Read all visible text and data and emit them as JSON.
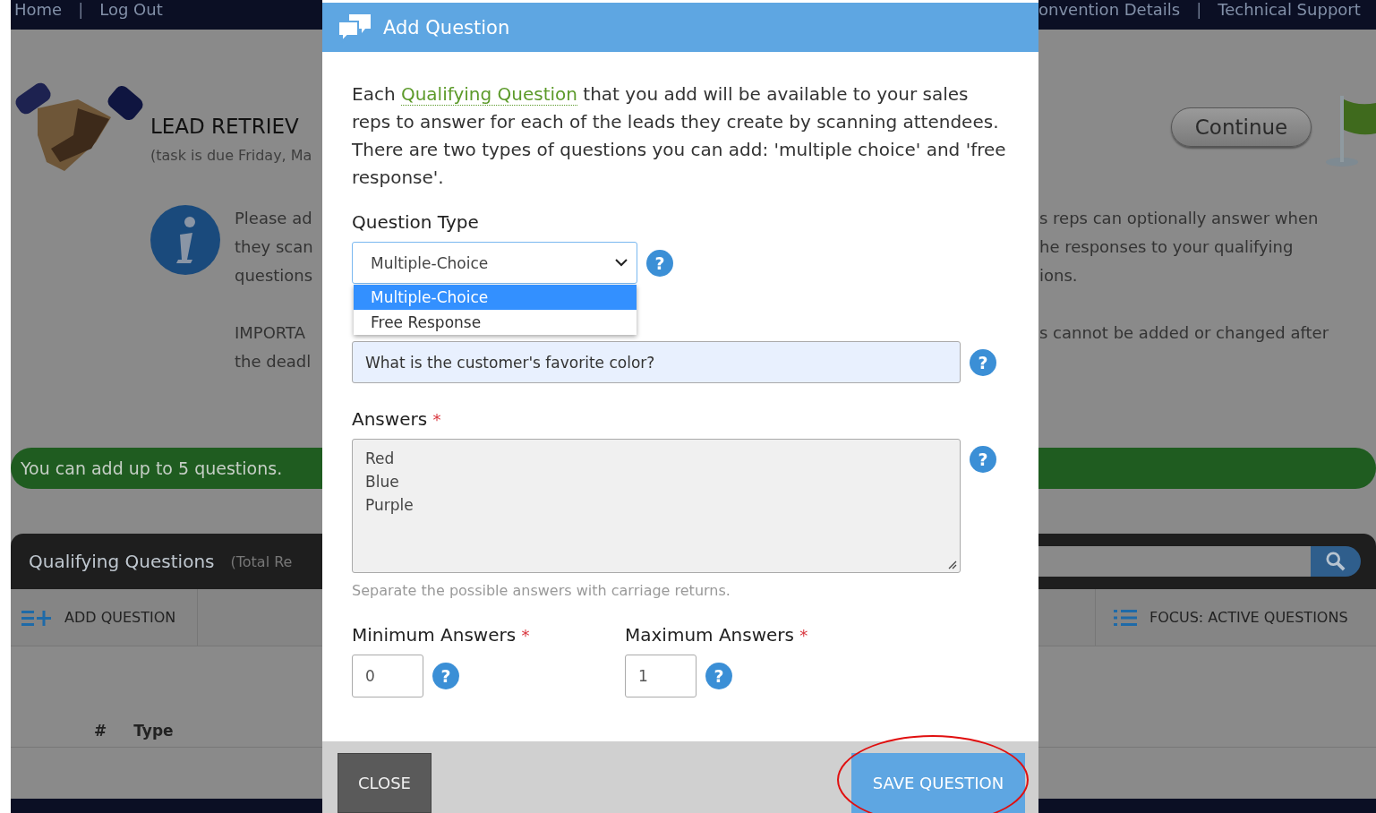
{
  "top_nav": {
    "left": [
      {
        "kind": "link",
        "text": "Home"
      },
      {
        "kind": "separator",
        "text": "|"
      },
      {
        "kind": "link",
        "text": "Log Out"
      }
    ],
    "right": [
      {
        "kind": "link",
        "text": "onvention Details"
      },
      {
        "kind": "separator",
        "text": "|"
      },
      {
        "kind": "link",
        "text": "Technical Support"
      }
    ]
  },
  "page": {
    "title": "LEAD RETRIEV",
    "subtitle": "(task is due Friday, Ma",
    "continue_button": "Continue",
    "info_left": [
      [
        "Please ad",
        "they scan",
        "questions"
      ],
      [
        "IMPORTA",
        "the deadl"
      ]
    ],
    "info_right": [
      [
        "s reps can optionally answer when",
        "he responses to your qualifying",
        "ions."
      ],
      [
        "s cannot be added or changed after"
      ]
    ],
    "banner": "You can add up to 5 questions.",
    "panel": {
      "title": "Qualifying Questions",
      "subtitle": "(Total Re",
      "add_button": "ADD QUESTION",
      "focus_button": "FOCUS: ACTIVE QUESTIONS",
      "columns": [
        "#",
        "Type"
      ]
    }
  },
  "modal": {
    "title": "Add Question",
    "intro_before": "Each ",
    "intro_link": "Qualifying Question",
    "intro_after": " that you add will be available to your sales reps to answer for each of the leads they create by scanning attendees. There are two types of questions you can add: 'multiple choice' and 'free response'.",
    "question_type": {
      "label": "Question Type",
      "value": "Multiple-Choice",
      "help": "?",
      "options": [
        {
          "text": "Multiple-Choice",
          "selected": true
        },
        {
          "text": "Free Response",
          "selected": false
        }
      ]
    },
    "question": {
      "value": "What is the customer's favorite color?",
      "help": "?"
    },
    "answers": {
      "label": "Answers",
      "required_mark": "*",
      "lines": [
        "Red",
        "Blue",
        "Purple"
      ],
      "help": "?",
      "hint": "Separate the possible answers with carriage returns."
    },
    "limits": [
      {
        "label": "Minimum Answers",
        "required_mark": "*",
        "value": "0",
        "help": "?"
      },
      {
        "label": "Maximum Answers",
        "required_mark": "*",
        "value": "1",
        "help": "?"
      }
    ],
    "close_button": "CLOSE",
    "save_button": {
      "text": "SAVE QUESTION",
      "highlighted": true
    }
  }
}
